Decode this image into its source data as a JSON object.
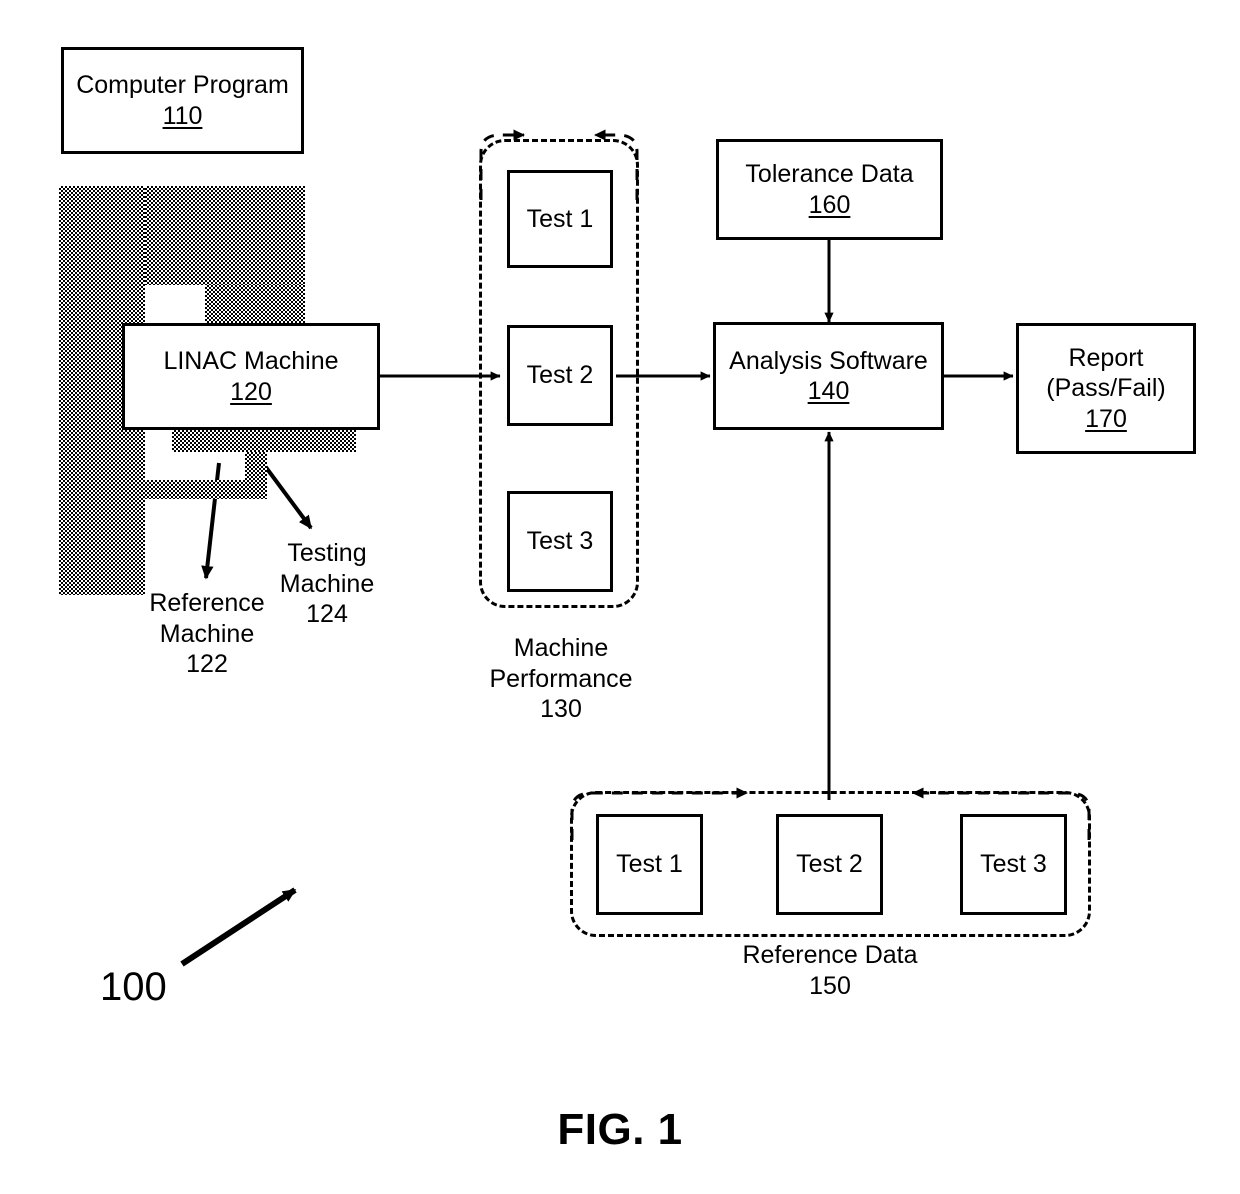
{
  "figure": {
    "caption": "FIG. 1",
    "system_number": "100"
  },
  "boxes": {
    "computer_program": {
      "title": "Computer Program",
      "ref": "110"
    },
    "linac_machine": {
      "title": "LINAC Machine",
      "ref": "120"
    },
    "tolerance_data": {
      "title": "Tolerance Data",
      "ref": "160"
    },
    "analysis_software": {
      "title": "Analysis Software",
      "ref": "140"
    },
    "report": {
      "line1": "Report",
      "line2": "(Pass/Fail)",
      "ref": "170"
    }
  },
  "machine_labels": {
    "reference_machine": "Reference\nMachine\n122",
    "testing_machine": "Testing\nMachine\n124"
  },
  "machine_performance": {
    "caption": "Machine\nPerformance\n130",
    "tests": [
      {
        "label": "Test 1"
      },
      {
        "label": "Test 2"
      },
      {
        "label": "Test 3"
      }
    ]
  },
  "reference_data": {
    "caption": "Reference Data\n150",
    "tests": [
      {
        "label": "Test 1"
      },
      {
        "label": "Test 2"
      },
      {
        "label": "Test 3"
      }
    ]
  },
  "style": {
    "stroke_color": "#000000",
    "background": "#ffffff"
  }
}
